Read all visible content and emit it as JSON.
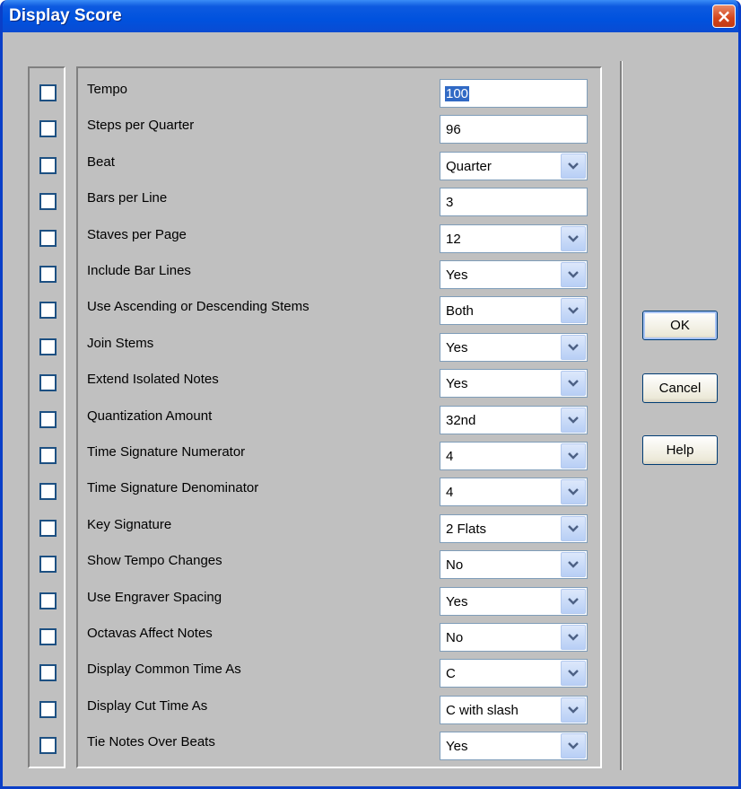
{
  "window": {
    "title": "Display Score",
    "close_symbol": "×"
  },
  "rows": [
    {
      "label": "Tempo",
      "value": "100",
      "type": "text",
      "checked": false
    },
    {
      "label": "Steps per Quarter",
      "value": "96",
      "type": "text",
      "checked": false
    },
    {
      "label": "Beat",
      "value": "Quarter",
      "type": "dropdown",
      "checked": false
    },
    {
      "label": "Bars per Line",
      "value": "3",
      "type": "text",
      "checked": false
    },
    {
      "label": "Staves per Page",
      "value": "12",
      "type": "dropdown",
      "checked": false
    },
    {
      "label": "Include Bar Lines",
      "value": "Yes",
      "type": "dropdown",
      "checked": false
    },
    {
      "label": "Use Ascending or Descending Stems",
      "value": "Both",
      "type": "dropdown",
      "checked": false
    },
    {
      "label": "Join Stems",
      "value": "Yes",
      "type": "dropdown",
      "checked": false
    },
    {
      "label": "Extend Isolated Notes",
      "value": "Yes",
      "type": "dropdown",
      "checked": false
    },
    {
      "label": "Quantization Amount",
      "value": "32nd",
      "type": "dropdown",
      "checked": false
    },
    {
      "label": "Time Signature Numerator",
      "value": "4",
      "type": "dropdown",
      "checked": false
    },
    {
      "label": "Time Signature Denominator",
      "value": "4",
      "type": "dropdown",
      "checked": false
    },
    {
      "label": "Key Signature",
      "value": "2 Flats",
      "type": "dropdown",
      "checked": false
    },
    {
      "label": "Show Tempo Changes",
      "value": "No",
      "type": "dropdown",
      "checked": false
    },
    {
      "label": "Use Engraver Spacing",
      "value": "Yes",
      "type": "dropdown",
      "checked": false
    },
    {
      "label": "Octavas Affect Notes",
      "value": "No",
      "type": "dropdown",
      "checked": false
    },
    {
      "label": "Display Common Time As",
      "value": "C",
      "type": "dropdown",
      "checked": false
    },
    {
      "label": "Display Cut Time As",
      "value": "C with slash",
      "type": "dropdown",
      "checked": false
    },
    {
      "label": "Tie Notes Over Beats",
      "value": "Yes",
      "type": "dropdown",
      "checked": false
    }
  ],
  "buttons": {
    "ok": "OK",
    "cancel": "Cancel",
    "help": "Help"
  },
  "colors": {
    "title_bar": "#0052de",
    "dialog_bg": "#c0c0c0",
    "close_button": "#d4451c",
    "selection": "#316ac5"
  }
}
